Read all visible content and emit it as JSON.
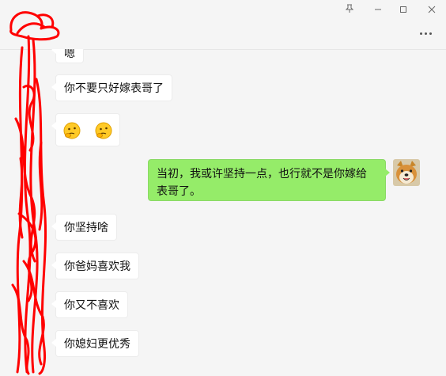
{
  "window": {
    "pin_icon": "pin-icon",
    "minimize_icon": "minimize-icon",
    "maximize_icon": "maximize-icon",
    "close_icon": "close-icon"
  },
  "header": {
    "more_icon": "more-dots-icon"
  },
  "messages": [
    {
      "side": "left",
      "text": "嗯"
    },
    {
      "side": "left",
      "text": "你不要只好嫁表哥了"
    },
    {
      "side": "left",
      "type": "emoji",
      "emojis": [
        "thinking-face-icon",
        "thinking-face-icon"
      ]
    },
    {
      "side": "right",
      "text": "当初，我或许坚持一点，也行就不是你嫁给表哥了。",
      "avatar": "shiba-dog-avatar"
    },
    {
      "side": "left",
      "text": "你坚持啥"
    },
    {
      "side": "left",
      "text": "你爸妈喜欢我"
    },
    {
      "side": "left",
      "text": "你又不喜欢"
    },
    {
      "side": "left",
      "text": "你媳妇更优秀"
    }
  ],
  "colors": {
    "sent_bubble": "#95ec69",
    "received_bubble": "#ffffff",
    "background": "#f5f5f5",
    "scribble": "#ff0000"
  }
}
